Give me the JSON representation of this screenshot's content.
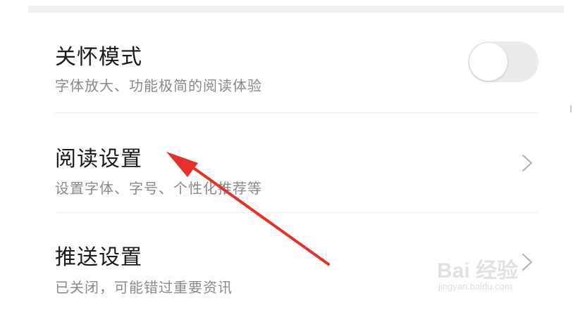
{
  "settings": [
    {
      "title": "关怀模式",
      "subtitle": "字体放大、功能极简的阅读体验",
      "control": "toggle",
      "toggle_on": false
    },
    {
      "title": "阅读设置",
      "subtitle": "设置字体、字号、个性化推荐等",
      "control": "chevron-right-icon"
    },
    {
      "title": "推送设置",
      "subtitle": "已关闭，可能错过重要资讯",
      "control": "chevron-right-icon"
    }
  ],
  "annotation": {
    "arrow_color": "#e8302a",
    "points_to": "阅读设置"
  },
  "watermark": {
    "main": "Bai 经验",
    "sub": "jingyan.baidu.com"
  },
  "colors": {
    "title": "#1a1a1a",
    "subtitle": "#8a8a8a",
    "toggle_off_track": "#ebebeb",
    "divider": "#ededed",
    "chevron": "#b5b5b5"
  }
}
